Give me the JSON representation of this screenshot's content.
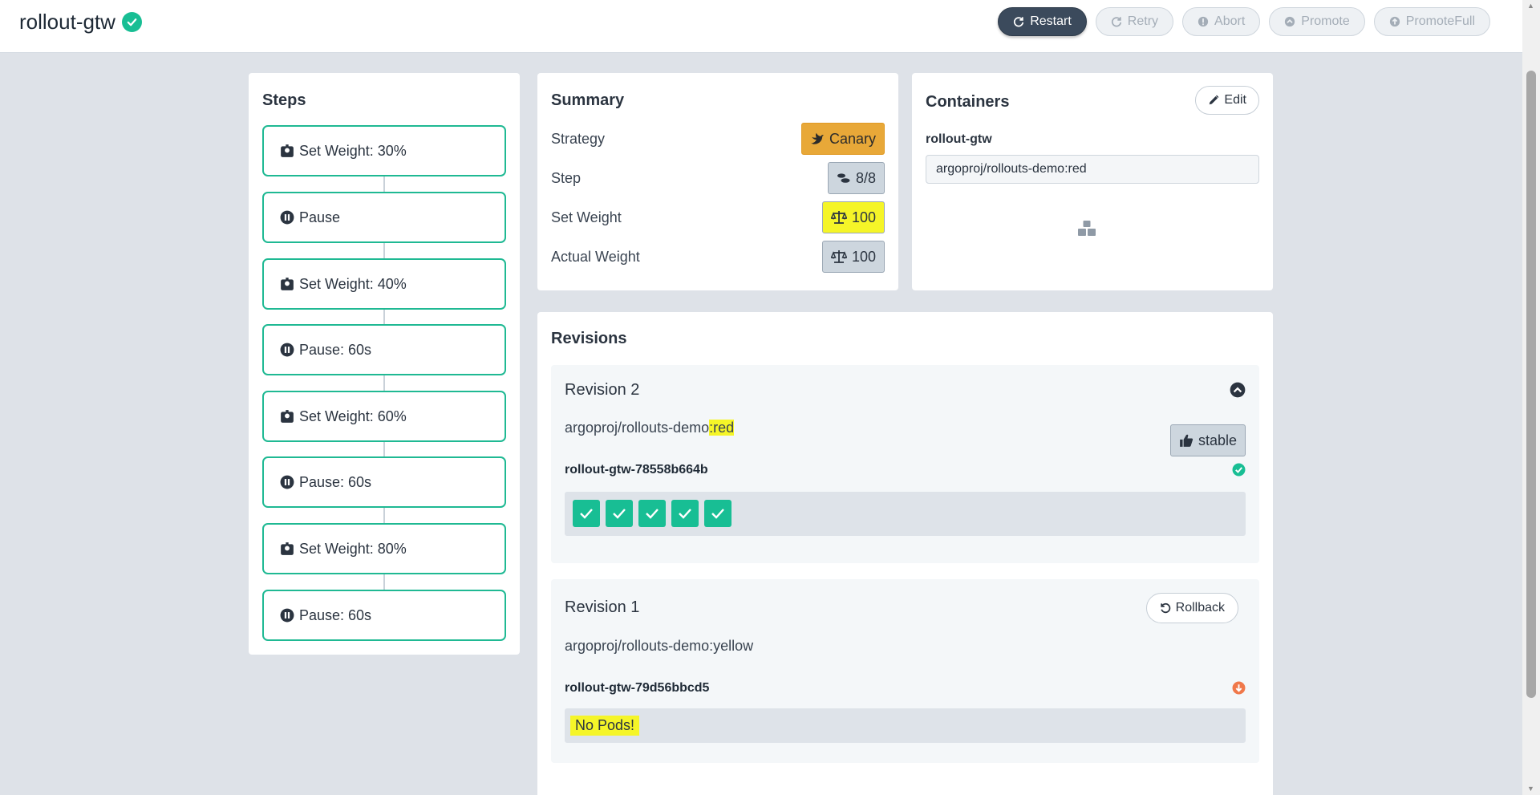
{
  "app": {
    "title": "rollout-gtw"
  },
  "actions": [
    {
      "label": "Restart",
      "icon": "refresh-icon",
      "enabled": true
    },
    {
      "label": "Retry",
      "icon": "retry-icon",
      "enabled": false
    },
    {
      "label": "Abort",
      "icon": "abort-icon",
      "enabled": false
    },
    {
      "label": "Promote",
      "icon": "promote-icon",
      "enabled": false
    },
    {
      "label": "PromoteFull",
      "icon": "promote-full-icon",
      "enabled": false
    }
  ],
  "steps": {
    "title": "Steps",
    "items": [
      {
        "label": "Set Weight: 30%",
        "icon": "weight-icon"
      },
      {
        "label": "Pause",
        "icon": "pause-icon"
      },
      {
        "label": "Set Weight: 40%",
        "icon": "weight-icon"
      },
      {
        "label": "Pause: 60s",
        "icon": "pause-icon"
      },
      {
        "label": "Set Weight: 60%",
        "icon": "weight-icon"
      },
      {
        "label": "Pause: 60s",
        "icon": "pause-icon"
      },
      {
        "label": "Set Weight: 80%",
        "icon": "weight-icon"
      },
      {
        "label": "Pause: 60s",
        "icon": "pause-icon"
      }
    ]
  },
  "summary": {
    "title": "Summary",
    "strategy": {
      "label": "Strategy",
      "value": "Canary"
    },
    "step": {
      "label": "Step",
      "value": "8/8"
    },
    "set_weight": {
      "label": "Set Weight",
      "value": "100"
    },
    "actual_weight": {
      "label": "Actual Weight",
      "value": "100"
    }
  },
  "containers": {
    "title": "Containers",
    "edit_label": "Edit",
    "name": "rollout-gtw",
    "image": "argoproj/rollouts-demo:red"
  },
  "revisions": {
    "title": "Revisions",
    "items": [
      {
        "title": "Revision 2",
        "image_prefix": "argoproj/rollouts-demo",
        "image_tag": ":red",
        "badge": "stable",
        "replicaset": "rollout-gtw-78558b664b",
        "pods_ready": 5,
        "status": "healthy"
      },
      {
        "title": "Revision 1",
        "image": "argoproj/rollouts-demo:yellow",
        "action": "Rollback",
        "replicaset": "rollout-gtw-79d56bbcd5",
        "empty_text": "No Pods!",
        "status": "scaled-down"
      }
    ]
  },
  "colors": {
    "accent": "#18be94",
    "canary": "#e8a838",
    "highlight": "#f5f528",
    "primary_button": "#3b4a5c",
    "warning": "#f0784a"
  }
}
